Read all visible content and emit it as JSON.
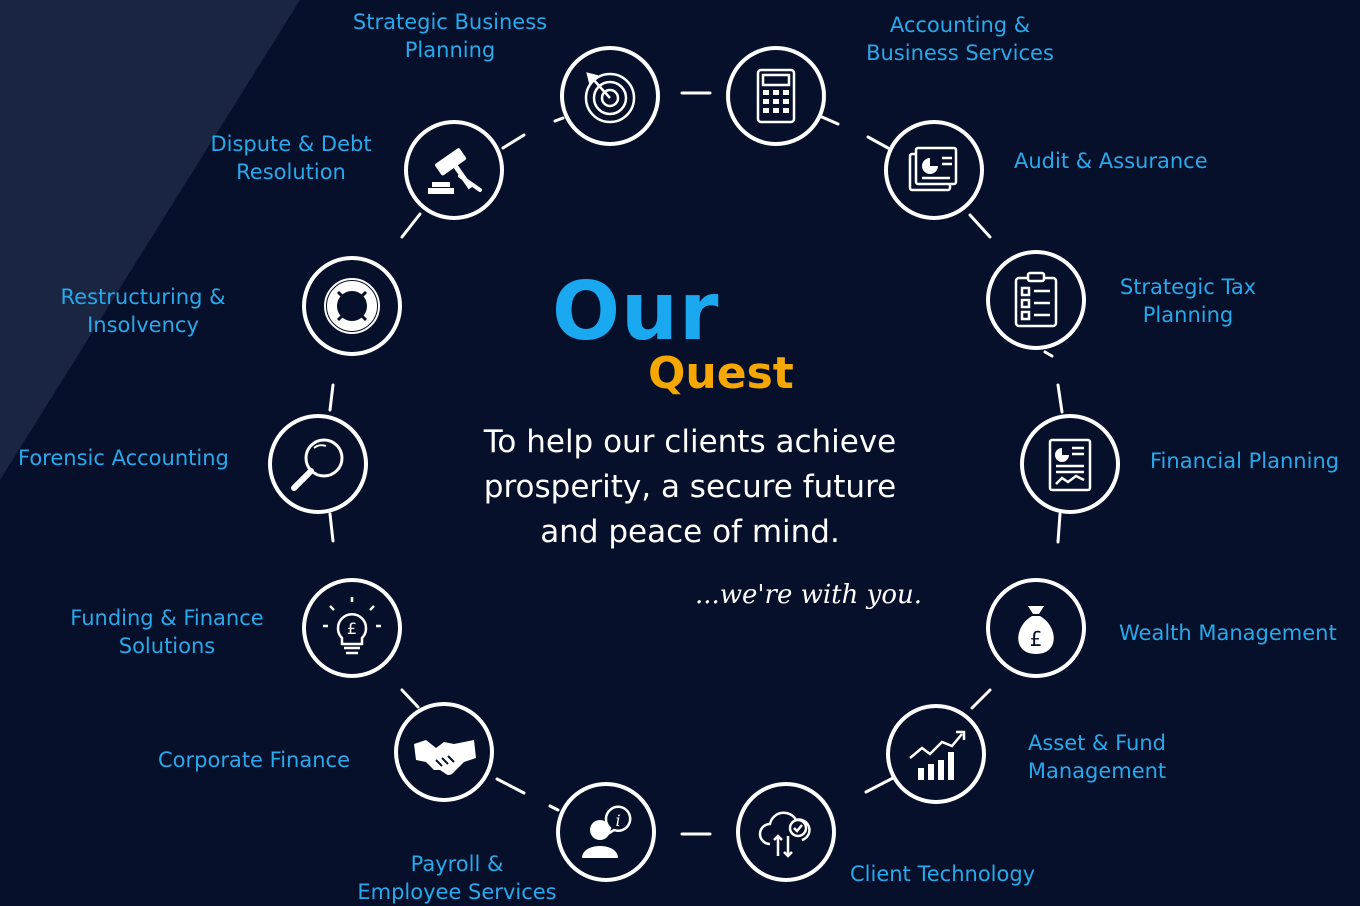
{
  "center": {
    "title_line1": "Our",
    "title_line2": "Quest",
    "mission_lines": [
      "To help our clients achieve",
      "prosperity, a secure future",
      "and peace of mind."
    ],
    "tagline": "...we're with you."
  },
  "colors": {
    "background": "#06102a",
    "label": "#27a9ec",
    "title_our": "#1aa8f0",
    "title_quest": "#f6a800",
    "ring": "#ffffff"
  },
  "services": [
    {
      "key": "strategic-business-planning",
      "icon": "target-icon",
      "lines": [
        "Strategic Business",
        "Planning"
      ]
    },
    {
      "key": "accounting-business-services",
      "icon": "calculator-icon",
      "lines": [
        "Accounting &",
        "Business Services"
      ]
    },
    {
      "key": "audit-assurance",
      "icon": "report-chart-icon",
      "lines": [
        "Audit & Assurance"
      ]
    },
    {
      "key": "strategic-tax-planning",
      "icon": "clipboard-checklist-icon",
      "lines": [
        "Strategic Tax",
        "Planning"
      ]
    },
    {
      "key": "financial-planning",
      "icon": "financial-document-icon",
      "lines": [
        "Financial Planning"
      ]
    },
    {
      "key": "wealth-management",
      "icon": "money-bag-icon",
      "lines": [
        "Wealth Management"
      ]
    },
    {
      "key": "asset-fund-management",
      "icon": "growth-chart-icon",
      "lines": [
        "Asset & Fund",
        "Management"
      ]
    },
    {
      "key": "client-technology",
      "icon": "cloud-sync-icon",
      "lines": [
        "Client Technology"
      ]
    },
    {
      "key": "payroll-employee-services",
      "icon": "person-info-icon",
      "lines": [
        "Payroll &",
        "Employee Services"
      ]
    },
    {
      "key": "corporate-finance",
      "icon": "handshake-icon",
      "lines": [
        "Corporate Finance"
      ]
    },
    {
      "key": "funding-finance-solutions",
      "icon": "lightbulb-icon",
      "lines": [
        "Funding & Finance",
        "Solutions"
      ]
    },
    {
      "key": "forensic-accounting",
      "icon": "magnifier-icon",
      "lines": [
        "Forensic Accounting"
      ]
    },
    {
      "key": "restructuring-insolvency",
      "icon": "lifebuoy-icon",
      "lines": [
        "Restructuring &",
        "Insolvency"
      ]
    },
    {
      "key": "dispute-debt-resolution",
      "icon": "gavel-icon",
      "lines": [
        "Dispute & Debt",
        "Resolution"
      ]
    }
  ]
}
